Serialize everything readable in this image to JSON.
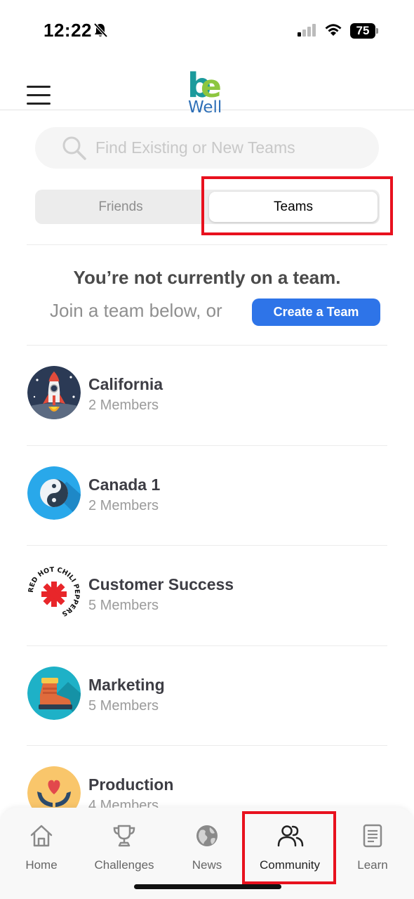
{
  "status_bar": {
    "time": "12:22",
    "battery": "75"
  },
  "header": {
    "logo_be_b": "b",
    "logo_be_e": "e",
    "logo_well": "Well"
  },
  "search": {
    "placeholder": "Find Existing or New Teams"
  },
  "tabs": {
    "friends": "Friends",
    "teams": "Teams",
    "selected": "Teams"
  },
  "empty_state": {
    "title": "You’re not currently on a team.",
    "join_text": "Join a team below, or",
    "create_button": "Create a Team"
  },
  "teams": [
    {
      "name": "California",
      "members": "2 Members",
      "icon": "rocket-icon"
    },
    {
      "name": "Canada 1",
      "members": "2 Members",
      "icon": "yin-yang-icon"
    },
    {
      "name": "Customer Success",
      "members": "5 Members",
      "icon": "red-hot-chili-peppers-logo"
    },
    {
      "name": "Marketing",
      "members": "5 Members",
      "icon": "boot-icon"
    },
    {
      "name": "Production",
      "members": "4 Members",
      "icon": "heart-hands-icon"
    }
  ],
  "logo_texts": {
    "rhcp": "RED HOT CHILI PEPPERS"
  },
  "bottom_nav": [
    {
      "label": "Home",
      "icon": "home-icon"
    },
    {
      "label": "Challenges",
      "icon": "trophy-icon"
    },
    {
      "label": "News",
      "icon": "globe-icon"
    },
    {
      "label": "Community",
      "icon": "community-icon",
      "active": true
    },
    {
      "label": "Learn",
      "icon": "document-icon"
    }
  ],
  "colors": {
    "accent_blue": "#2e74e8",
    "highlight_red": "#e8111e",
    "logo_teal": "#1b9a9c",
    "logo_green": "#8dc63f",
    "logo_blue": "#2e6fb7"
  }
}
